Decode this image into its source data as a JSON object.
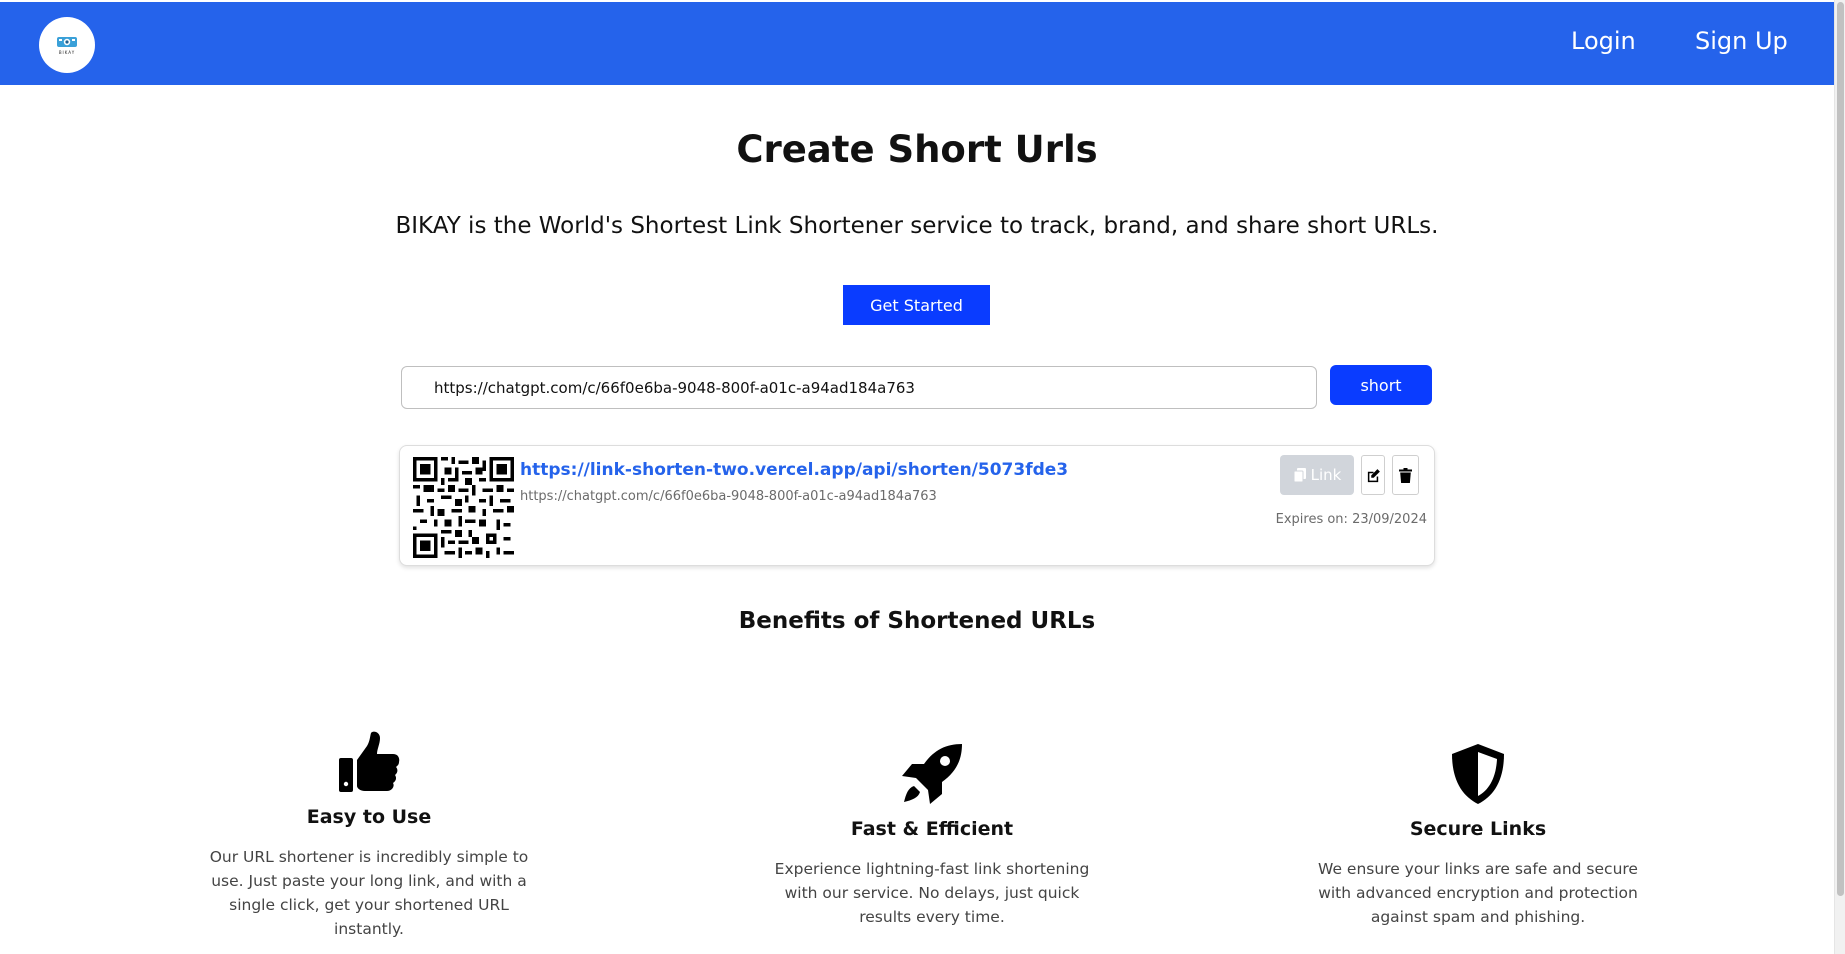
{
  "nav": {
    "logo_text": "BIKAY",
    "login": "Login",
    "signup": "Sign Up"
  },
  "hero": {
    "title": "Create Short Urls",
    "subtitle": "BIKAY is the World's Shortest Link Shortener service to track, brand, and share short URLs.",
    "cta": "Get Started"
  },
  "form": {
    "url_value": "https://chatgpt.com/c/66f0e6ba-9048-800f-a01c-a94ad184a763",
    "submit": "short"
  },
  "result": {
    "short_url": "https://link-shorten-two.vercel.app/api/shorten/5073fde3",
    "original_url": "https://chatgpt.com/c/66f0e6ba-9048-800f-a01c-a94ad184a763",
    "copy_label": "Link",
    "expires": "Expires on: 23/09/2024"
  },
  "benefits": {
    "title": "Benefits of Shortened URLs",
    "items": [
      {
        "icon": "thumbs-up-icon",
        "title": "Easy to Use",
        "text": "Our URL shortener is incredibly simple to use. Just paste your long link, and with a single click, get your shortened URL instantly."
      },
      {
        "icon": "rocket-icon",
        "title": "Fast & Efficient",
        "text": "Experience lightning-fast link shortening with our service. No delays, just quick results every time."
      },
      {
        "icon": "shield-icon",
        "title": "Secure Links",
        "text": "We ensure your links are safe and secure with advanced encryption and protection against spam and phishing."
      }
    ]
  },
  "colors": {
    "navbar": "#2563eb",
    "primary_button": "#0a3cff",
    "link": "#2563eb",
    "disabled_button": "#d1d5db"
  }
}
